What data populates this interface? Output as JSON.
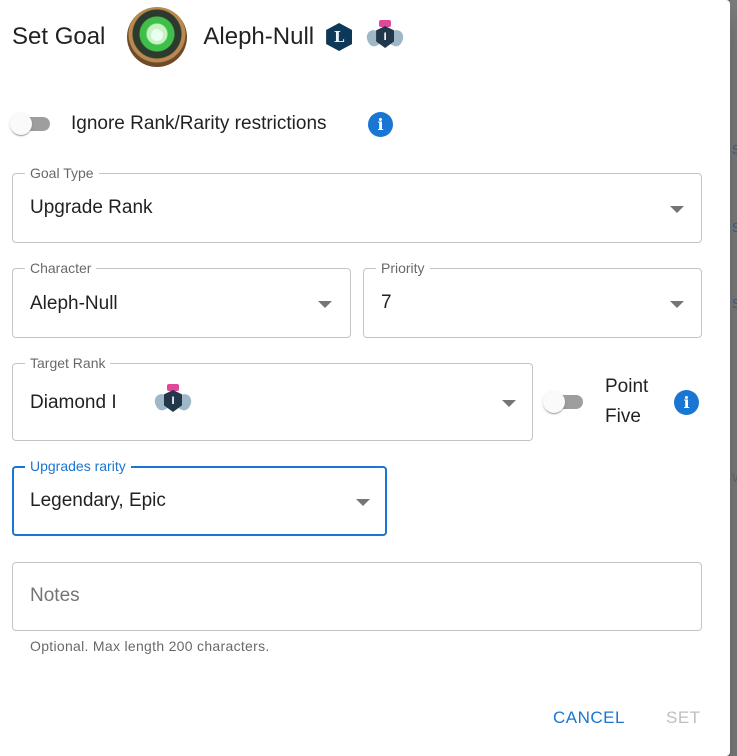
{
  "dialog": {
    "title": "Set Goal",
    "character_name": "Aleph-Null",
    "rarity_letter": "L"
  },
  "ignore_switch": {
    "label": "Ignore Rank/Rarity restrictions",
    "checked": false
  },
  "fields": {
    "goal_type": {
      "label": "Goal Type",
      "value": "Upgrade Rank"
    },
    "character": {
      "label": "Character",
      "value": "Aleph-Null"
    },
    "priority": {
      "label": "Priority",
      "value": "7"
    },
    "target_rank": {
      "label": "Target Rank",
      "value": "Diamond I"
    },
    "upgrades_rarity": {
      "label": "Upgrades rarity",
      "value": "Legendary, Epic"
    },
    "notes": {
      "placeholder": "Notes",
      "helper": "Optional. Max length 200 characters."
    }
  },
  "point_five": {
    "label_line1": "Point",
    "label_line2": "Five",
    "checked": false
  },
  "icons": {
    "info": "i",
    "rank_badge_mark": "I"
  },
  "actions": {
    "cancel": "CANCEL",
    "set": "SET"
  },
  "colors": {
    "primary": "#1976d2",
    "rarity_legendary": "#0d3858",
    "rank_crown": "#e0489a"
  }
}
